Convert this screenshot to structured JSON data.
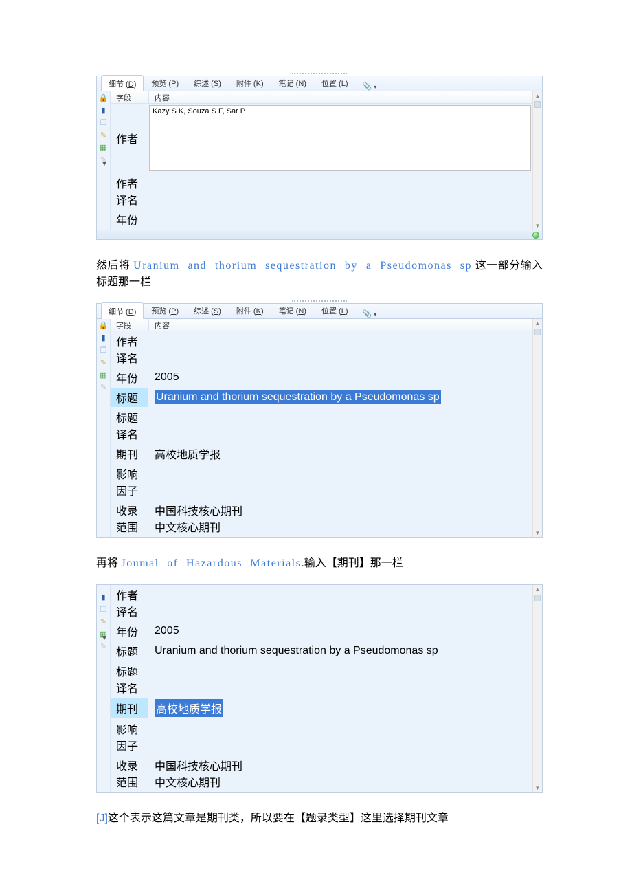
{
  "tabs": [
    {
      "label": "细节",
      "key": "D"
    },
    {
      "label": "预览",
      "key": "P"
    },
    {
      "label": "综述",
      "key": "S"
    },
    {
      "label": "附件",
      "key": "K"
    },
    {
      "label": "笔记",
      "key": "N"
    },
    {
      "label": "位置",
      "key": "L"
    }
  ],
  "header": {
    "field": "字段",
    "value": "内容"
  },
  "panel1": {
    "rows": [
      {
        "field": "作者",
        "value": "Kazy S K, Souza S F, Sar P",
        "tall": true,
        "editable": true
      },
      {
        "field": "作者译名",
        "value": ""
      },
      {
        "field": "年份",
        "value": ""
      }
    ]
  },
  "text1_pre": "然后将",
  "text1_eng": "Uranium  and  thorium  sequestration  by  a Pseudomonas  sp",
  "text1_post": "这一部分输入标题那一栏",
  "panel2": {
    "rows": [
      {
        "field": "作者译名",
        "value": ""
      },
      {
        "field": "年份",
        "value": "2005"
      },
      {
        "field": "标题",
        "value": "Uranium and thorium sequestration by a Pseudomonas sp",
        "sel_blue": true,
        "hilite": true
      },
      {
        "field": "标题译名",
        "value": ""
      },
      {
        "field": "期刊",
        "value": "高校地质学报"
      },
      {
        "field": "影响因子",
        "value": ""
      },
      {
        "field": "收录范围",
        "value": "中国科技核心期刊\n中文核心期刊"
      }
    ]
  },
  "text2_pre": "再将",
  "text2_eng": "Joumal  of  Hazardous  Materials",
  "text2_post": ".输入【期刊】那一栏",
  "panel3": {
    "rows": [
      {
        "field": "作者译名",
        "value": ""
      },
      {
        "field": "年份",
        "value": "2005"
      },
      {
        "field": "标题",
        "value": "Uranium and thorium sequestration by a Pseudomonas sp"
      },
      {
        "field": "标题译名",
        "value": ""
      },
      {
        "field": "期刊",
        "value": "高校地质学报",
        "sel_blue": true,
        "hilite": true
      },
      {
        "field": "影响因子",
        "value": ""
      },
      {
        "field": "收录范围",
        "value": "中国科技核心期刊\n中文核心期刊"
      }
    ]
  },
  "text3_code": "[J]",
  "text3_post": "这个表示这篇文章是期刊类，所以要在【题录类型】这里选择期刊文章"
}
